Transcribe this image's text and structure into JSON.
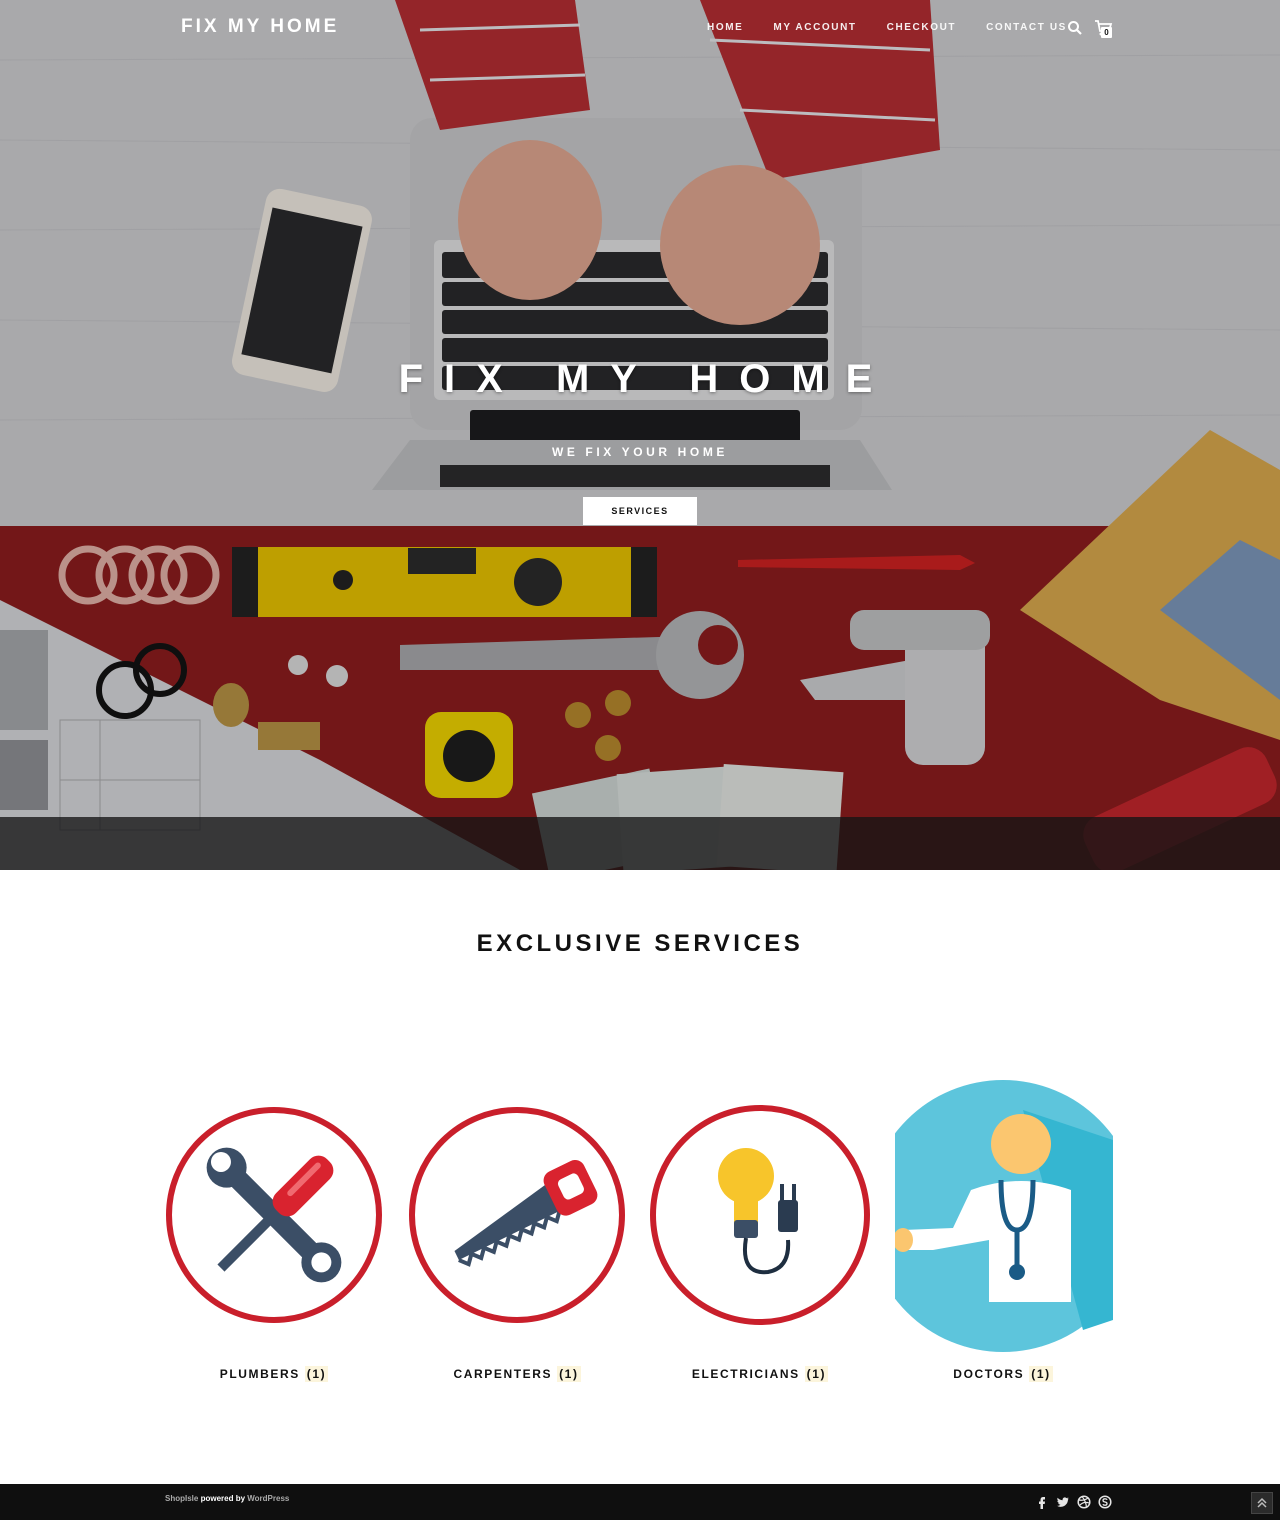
{
  "header": {
    "brand": "FIX MY HOME",
    "menu": [
      "HOME",
      "MY ACCOUNT",
      "CHECKOUT",
      "CONTACT US"
    ],
    "cart_count": "0"
  },
  "hero": {
    "title": "FIX MY HOME",
    "subtitle": "WE FIX YOUR HOME",
    "button": "SERVICES"
  },
  "services": {
    "title": "EXCLUSIVE SERVICES",
    "categories": [
      {
        "name": "PLUMBERS",
        "count": "(1)",
        "icon": "wrench-screwdriver-icon"
      },
      {
        "name": "CARPENTERS",
        "count": "(1)",
        "icon": "saw-icon"
      },
      {
        "name": "ELECTRICIANS",
        "count": "(1)",
        "icon": "lightbulb-plug-icon"
      },
      {
        "name": "DOCTORS",
        "count": "(1)",
        "icon": "doctor-icon"
      }
    ]
  },
  "footer": {
    "theme": "ShopIsle",
    "powered": "powered by",
    "platform": "WordPress",
    "social": [
      "facebook-icon",
      "twitter-icon",
      "dribbble-icon",
      "skype-icon"
    ]
  },
  "colors": {
    "accent_red": "#d0202b",
    "doctor_blue": "#5dc5dc",
    "footer_bg": "#0f0f0f"
  }
}
